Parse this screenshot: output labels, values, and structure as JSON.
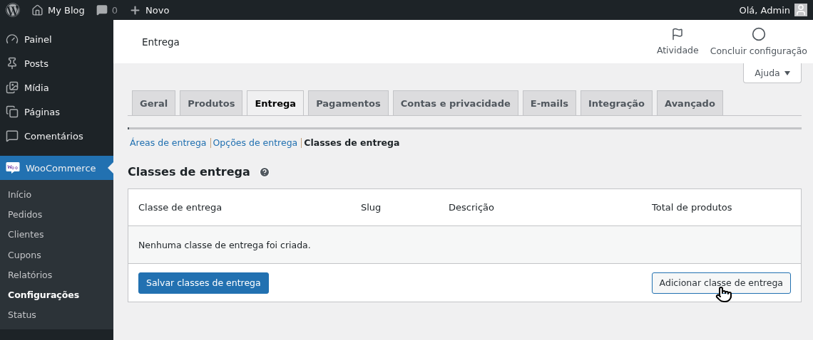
{
  "top_bar": {
    "site": "My Blog",
    "comments": "0",
    "new": "Novo",
    "greeting": "Olá, Admin"
  },
  "sidebar": {
    "items": [
      {
        "label": "Painel",
        "kind": "gauge",
        "selected": false
      },
      {
        "label": "Posts",
        "kind": "pin",
        "selected": false
      },
      {
        "label": "Mídia",
        "kind": "media",
        "selected": false
      },
      {
        "label": "Páginas",
        "kind": "pages",
        "selected": false
      },
      {
        "label": "Comentários",
        "kind": "comment",
        "selected": false
      },
      {
        "label": "WooCommerce",
        "kind": "woo",
        "selected": true,
        "children": [
          {
            "label": "Início",
            "selected": false
          },
          {
            "label": "Pedidos",
            "selected": false
          },
          {
            "label": "Clientes",
            "selected": false
          },
          {
            "label": "Cupons",
            "selected": false
          },
          {
            "label": "Relatórios",
            "selected": false
          },
          {
            "label": "Configurações",
            "selected": true
          },
          {
            "label": "Status",
            "selected": false
          }
        ]
      }
    ]
  },
  "header": {
    "title": "Entrega",
    "actions": [
      {
        "label": "Atividade",
        "kind": "flag"
      },
      {
        "label": "Concluir configuração",
        "kind": "circle"
      }
    ]
  },
  "help_button": "Ajuda",
  "tabs": [
    {
      "label": "Geral",
      "selected": false
    },
    {
      "label": "Produtos",
      "selected": false
    },
    {
      "label": "Entrega",
      "selected": true
    },
    {
      "label": "Pagamentos",
      "selected": false
    },
    {
      "label": "Contas e privacidade",
      "selected": false
    },
    {
      "label": "E-mails",
      "selected": false
    },
    {
      "label": "Integração",
      "selected": false
    },
    {
      "label": "Avançado",
      "selected": false
    }
  ],
  "sub_tabs": [
    {
      "label": "Áreas de entrega",
      "selected": false
    },
    {
      "label": "Opções de entrega",
      "selected": false
    },
    {
      "label": "Classes de entrega",
      "selected": true
    }
  ],
  "section_title": "Classes de entrega",
  "table": {
    "columns": [
      "Classe de entrega",
      "Slug",
      "Descrição",
      "Total de produtos"
    ],
    "empty_message": "Nenhuma classe de entrega foi criada."
  },
  "buttons": {
    "save": "Salvar classes de entrega",
    "add": "Adicionar classe de entrega"
  }
}
